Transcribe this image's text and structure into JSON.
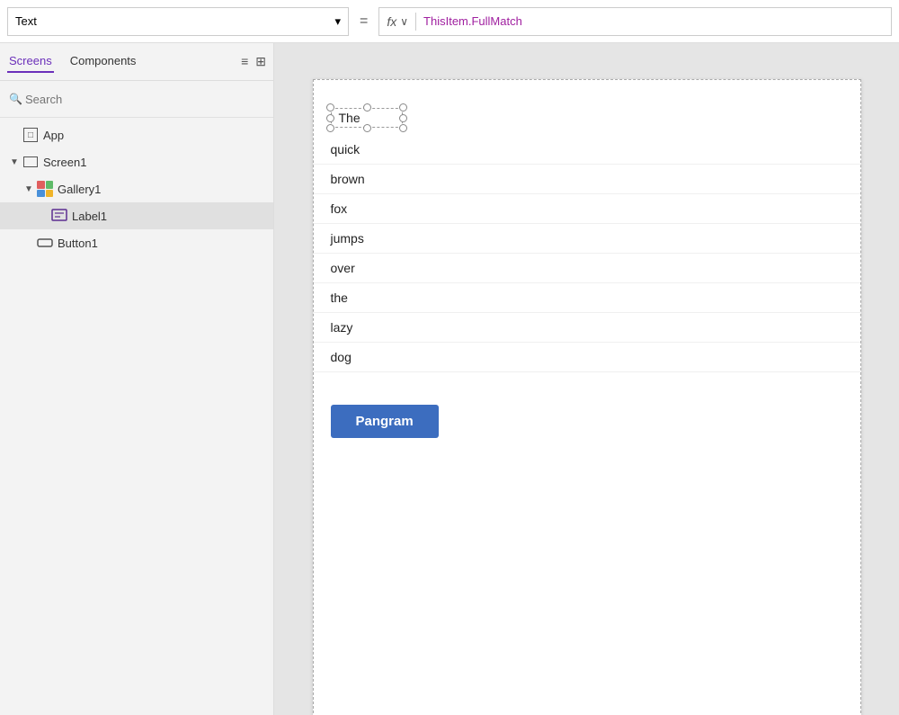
{
  "formulaBar": {
    "propertyLabel": "Text",
    "equalsSign": "=",
    "fxLabel": "fx",
    "fxChevron": "∨",
    "formula": "ThisItem.FullMatch"
  },
  "leftPanel": {
    "tabs": [
      {
        "id": "screens",
        "label": "Screens",
        "active": true
      },
      {
        "id": "components",
        "label": "Components",
        "active": false
      }
    ],
    "searchPlaceholder": "Search",
    "tree": [
      {
        "id": "app",
        "label": "App",
        "indent": 0,
        "chevron": "",
        "icon": "app",
        "selected": false
      },
      {
        "id": "screen1",
        "label": "Screen1",
        "indent": 1,
        "chevron": "▼",
        "icon": "screen",
        "selected": false
      },
      {
        "id": "gallery1",
        "label": "Gallery1",
        "indent": 2,
        "chevron": "▼",
        "icon": "gallery",
        "selected": false
      },
      {
        "id": "label1",
        "label": "Label1",
        "indent": 3,
        "chevron": "",
        "icon": "label",
        "selected": true
      },
      {
        "id": "button1",
        "label": "Button1",
        "indent": 2,
        "chevron": "",
        "icon": "button",
        "selected": false
      }
    ]
  },
  "canvas": {
    "galleryItems": [
      {
        "id": 1,
        "text": "The",
        "selected": true
      },
      {
        "id": 2,
        "text": "quick",
        "selected": false
      },
      {
        "id": 3,
        "text": "brown",
        "selected": false
      },
      {
        "id": 4,
        "text": "fox",
        "selected": false
      },
      {
        "id": 5,
        "text": "jumps",
        "selected": false
      },
      {
        "id": 6,
        "text": "over",
        "selected": false
      },
      {
        "id": 7,
        "text": "the",
        "selected": false
      },
      {
        "id": 8,
        "text": "lazy",
        "selected": false
      },
      {
        "id": 9,
        "text": "dog",
        "selected": false
      }
    ],
    "buttonLabel": "Pangram"
  }
}
